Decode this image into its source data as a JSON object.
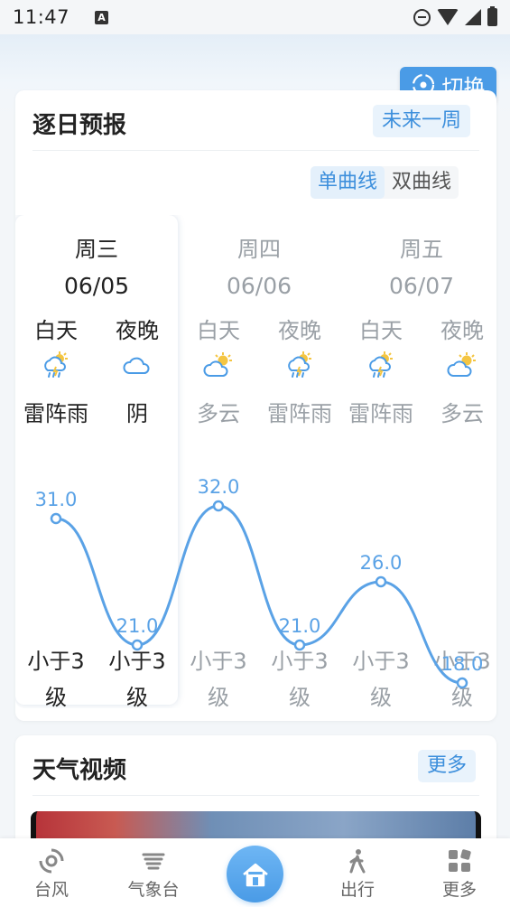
{
  "status_bar": {
    "time": "11:47",
    "notif_letter": "A"
  },
  "header": {
    "switch_label": "切换"
  },
  "daily": {
    "title": "逐日预报",
    "range_button": "未来一周",
    "toggle": [
      "单曲线",
      "双曲线"
    ],
    "active_toggle": 0,
    "days": [
      {
        "week": "周三",
        "date": "06/05",
        "day": {
          "label": "白天",
          "icon": "thunder-rain-icon",
          "cond": "雷阵雨",
          "temp": "31.0",
          "wind": [
            "小于3",
            "级"
          ]
        },
        "night": {
          "label": "夜晚",
          "icon": "cloud-icon",
          "cond": "阴",
          "temp": "21.0",
          "wind": [
            "小于3",
            "级"
          ]
        }
      },
      {
        "week": "周四",
        "date": "06/06",
        "day": {
          "label": "白天",
          "icon": "partly-cloudy-icon",
          "cond": "多云",
          "temp": "32.0",
          "wind": [
            "小于3",
            "级"
          ]
        },
        "night": {
          "label": "夜晚",
          "icon": "thunder-rain-icon",
          "cond": "雷阵雨",
          "temp": "21.0",
          "wind": [
            "小于3",
            "级"
          ]
        }
      },
      {
        "week": "周五",
        "date": "06/07",
        "day": {
          "label": "白天",
          "icon": "thunder-rain-icon",
          "cond": "雷阵雨",
          "temp": "26.0",
          "wind": [
            "小于3",
            "级"
          ]
        },
        "night": {
          "label": "夜晚",
          "icon": "partly-cloudy-icon",
          "cond": "多云",
          "temp": "18.0",
          "wind": [
            "小于3",
            "级"
          ]
        }
      }
    ],
    "temp_range": [
      15,
      35
    ]
  },
  "video": {
    "title": "天气视频",
    "more": "更多"
  },
  "nav": {
    "items": [
      {
        "label": "台风",
        "icon": "typhoon-icon"
      },
      {
        "label": "气象台",
        "icon": "weather-station-icon"
      },
      {
        "label": "",
        "icon": "home-icon"
      },
      {
        "label": "出行",
        "icon": "walking-icon"
      },
      {
        "label": "更多",
        "icon": "grid-icon"
      }
    ]
  },
  "colors": {
    "accent": "#4a9be6",
    "curve": "#5aa2e6",
    "text_dim": "#9aa0a6"
  }
}
